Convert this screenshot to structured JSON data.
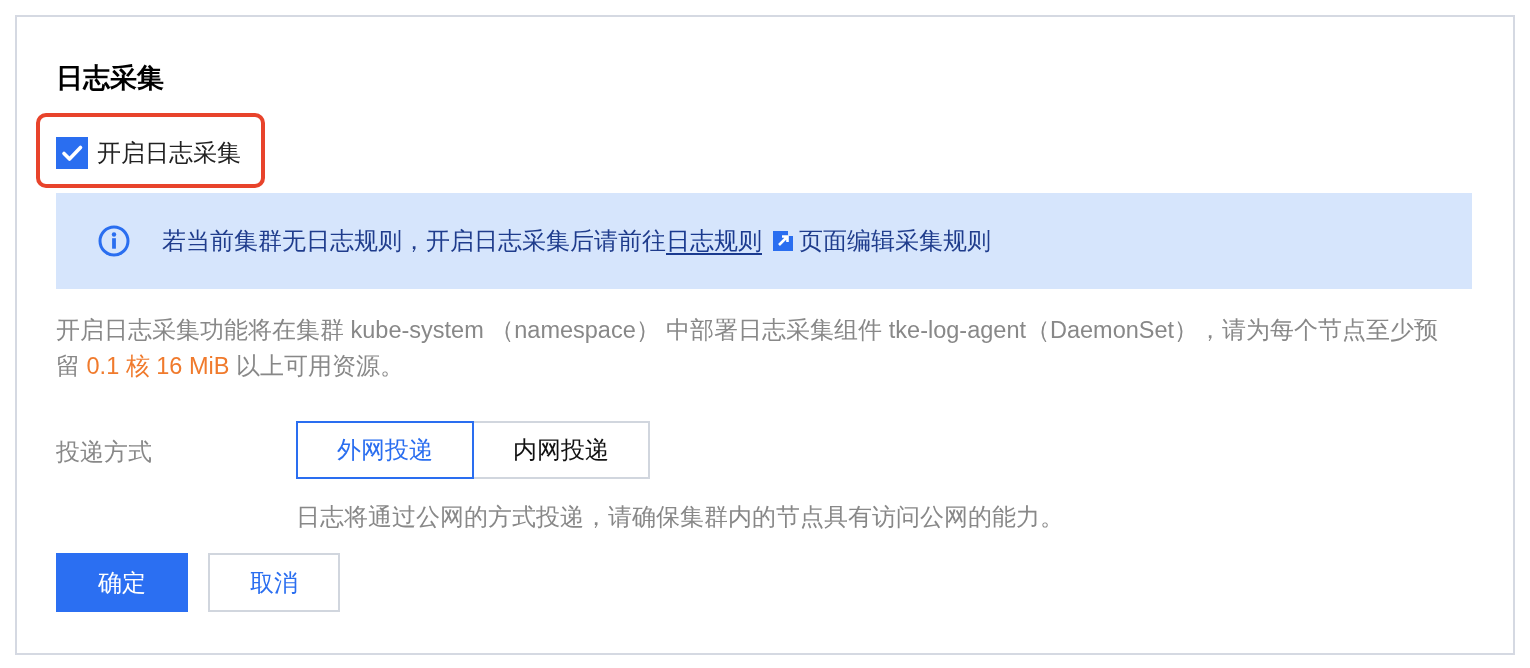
{
  "section": {
    "title": "日志采集"
  },
  "log_collection": {
    "checkbox": {
      "label": "开启日志采集",
      "checked": true,
      "highlighted": true
    }
  },
  "notice": {
    "before": "若当前集群无日志规则，开启日志采集后请前往",
    "link": "日志规则",
    "after": "页面编辑采集规则"
  },
  "description": {
    "before": "开启日志采集功能将在集群 kube-system （namespace） 中部署日志采集组件 tke-log-agent（DaemonSet），请为每个节点至少预留 ",
    "highlight": "0.1 核 16 MiB",
    "after": " 以上可用资源。"
  },
  "delivery": {
    "label": "投递方式",
    "options": [
      {
        "label": "外网投递",
        "selected": true
      },
      {
        "label": "内网投递",
        "selected": false
      }
    ],
    "hint": "日志将通过公网的方式投递，请确保集群内的节点具有访问公网的能力。"
  },
  "buttons": [
    {
      "label": "确定",
      "kind": "primary"
    },
    {
      "label": "取消",
      "kind": "secondary"
    }
  ]
}
